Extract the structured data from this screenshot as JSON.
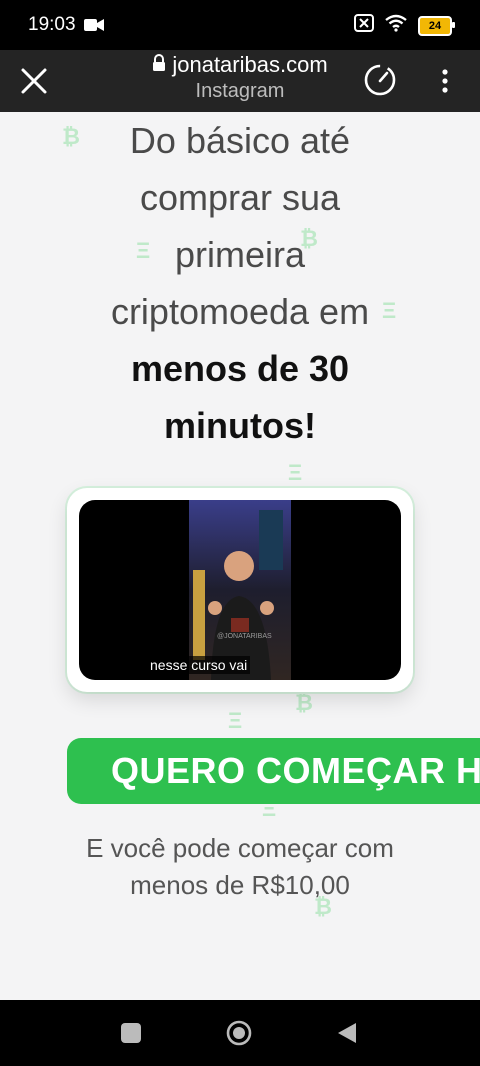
{
  "status": {
    "time": "19:03",
    "battery": "24",
    "icons": [
      "video-camera-icon",
      "sim-off-icon",
      "wifi-icon",
      "battery-icon"
    ]
  },
  "browser": {
    "url": "jonataribas.com",
    "source": "Instagram",
    "icons": [
      "close-icon",
      "lock-icon",
      "speed-icon",
      "more-vertical-icon"
    ]
  },
  "hero": {
    "line1": "Do básico até",
    "line2": "comprar sua",
    "line3": "primeira",
    "line4": "criptomoeda em",
    "bold1": "menos de 30",
    "bold2": "minutos!"
  },
  "video": {
    "caption": "nesse curso vai",
    "watermark": "@JONATARIBAS"
  },
  "cta": {
    "label": "QUERO COMEÇAR HOJE"
  },
  "subtext": {
    "line1": "E você pode começar com",
    "line2": "menos de R$10,00"
  },
  "colors": {
    "accent": "#2ec04f",
    "browser_bar": "#242424",
    "page_bg": "#f4f4f5",
    "deco": "#bfe9c9"
  },
  "nav": {
    "icons": [
      "recents-square-icon",
      "home-circle-icon",
      "back-triangle-icon"
    ]
  }
}
